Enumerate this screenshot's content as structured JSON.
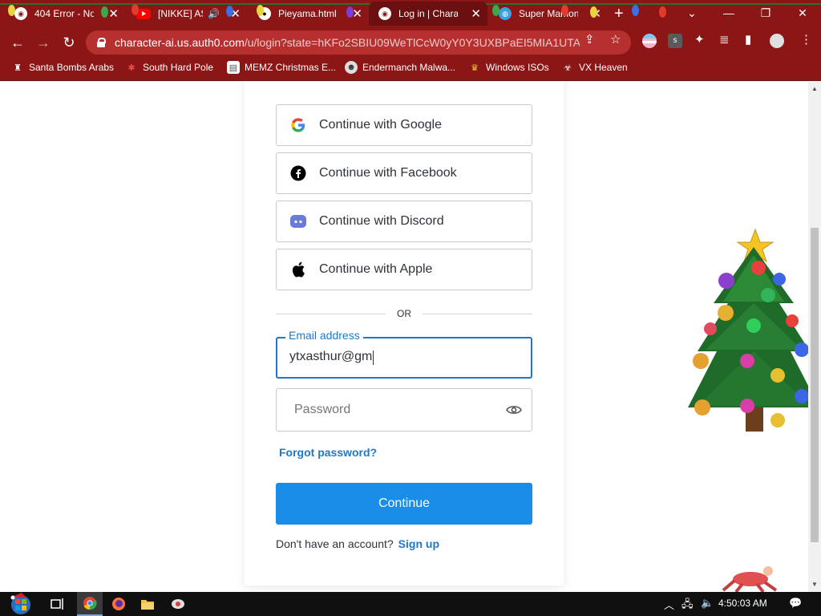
{
  "browser": {
    "tabs": [
      {
        "title": "404 Error - Not",
        "favicon": "chrome-icon",
        "active": false
      },
      {
        "title": "[NIKKE] AS",
        "favicon": "youtube-icon",
        "active": false
      },
      {
        "title": "Pieyama.html |",
        "favicon": "panda-icon",
        "active": false
      },
      {
        "title": "Log in | Characte",
        "favicon": "chrome-icon",
        "active": true
      },
      {
        "title": "Super Mamono",
        "favicon": "globe-icon",
        "active": false
      }
    ],
    "url_host": "character-ai.us.auth0.com",
    "url_path": "/u/login?state=hKFo2SBIU09WeTlCcW0yY0Y3UXBPaEI5MIA1UTAw...",
    "bookmarks": [
      {
        "label": "Santa Bombs Arabs",
        "icon": "santa-icon"
      },
      {
        "label": "South Hard Pole",
        "icon": "snowflake-icon"
      },
      {
        "label": "MEMZ Christmas E...",
        "icon": "doc-icon"
      },
      {
        "label": "Endermanch Malwa...",
        "icon": "skull-icon"
      },
      {
        "label": "Windows ISOs",
        "icon": "trophy-icon"
      },
      {
        "label": "VX Heaven",
        "icon": "biohazard-icon"
      }
    ],
    "accent_color": "#8c1616"
  },
  "login": {
    "google_label": "Continue with Google",
    "facebook_label": "Continue with Facebook",
    "discord_label": "Continue with Discord",
    "apple_label": "Continue with Apple",
    "divider_text": "OR",
    "email_label": "Email address",
    "email_value": "ytxasthur@gm",
    "password_placeholder": "Password",
    "forgot_label": "Forgot password?",
    "continue_label": "Continue",
    "no_account_text": "Don't have an account?",
    "signup_label": "Sign up",
    "primary_color": "#1a8de8",
    "link_color": "#1e78c8"
  },
  "taskbar": {
    "clock": "4:50:03 AM"
  }
}
